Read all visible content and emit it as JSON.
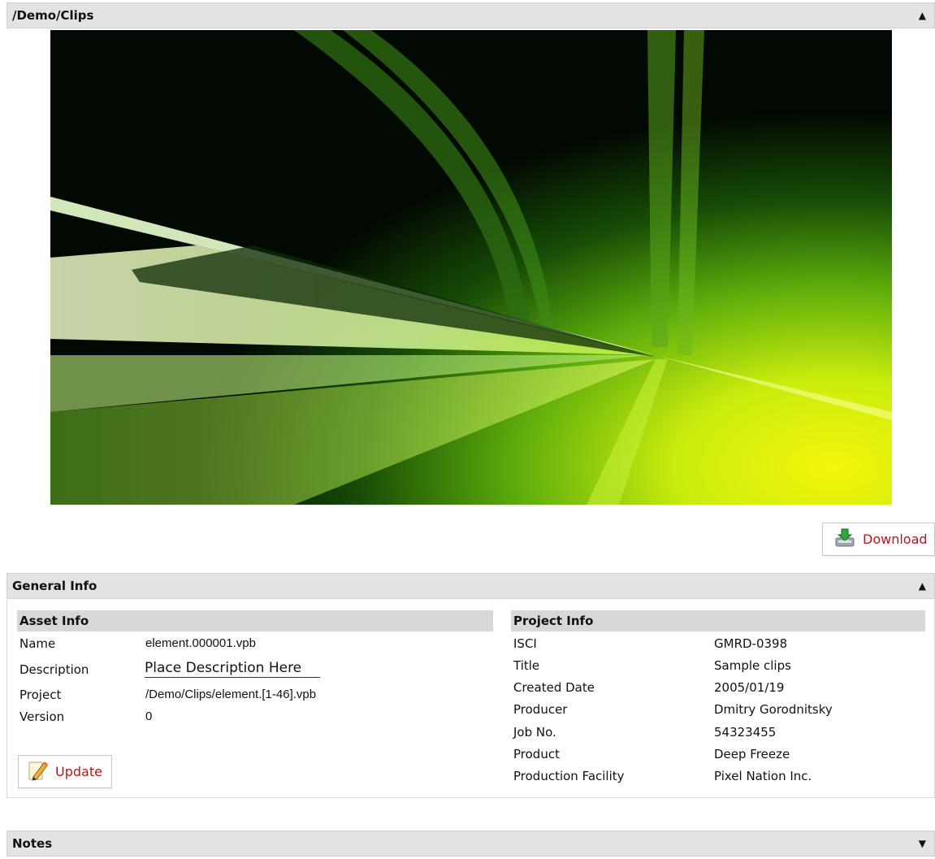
{
  "clips_panel": {
    "title": "/Demo/Clips",
    "collapse_icon": "triangle-up-icon"
  },
  "download": {
    "label": "Download",
    "icon": "download-tray-icon"
  },
  "general_panel": {
    "title": "General Info",
    "collapse_icon": "triangle-up-icon"
  },
  "asset_info": {
    "heading": "Asset Info",
    "fields": [
      {
        "label": "Name",
        "value": "element.000001.vpb"
      },
      {
        "label": "Description",
        "value": "Place Description Here"
      },
      {
        "label": "Project",
        "value": "/Demo/Clips/element.[1-46].vpb"
      },
      {
        "label": "Version",
        "value": "0"
      }
    ],
    "update_label": "Update",
    "update_icon": "pencil-note-icon"
  },
  "project_info": {
    "heading": "Project Info",
    "fields": [
      {
        "label": "ISCI",
        "value": "GMRD-0398"
      },
      {
        "label": "Title",
        "value": "Sample clips"
      },
      {
        "label": "Created Date",
        "value": "2005/01/19"
      },
      {
        "label": "Producer",
        "value": "Dmitry Gorodnitsky"
      },
      {
        "label": "Job No.",
        "value": "54323455"
      },
      {
        "label": "Product",
        "value": "Deep Freeze"
      },
      {
        "label": "Production Facility",
        "value": "Pixel Nation Inc."
      }
    ]
  },
  "notes_panel": {
    "title": "Notes",
    "expand_icon": "triangle-down-icon"
  },
  "colors": {
    "link_red": "#b2181d",
    "header_gray": "#e3e3e3",
    "section_gray": "#d8d8d8"
  }
}
